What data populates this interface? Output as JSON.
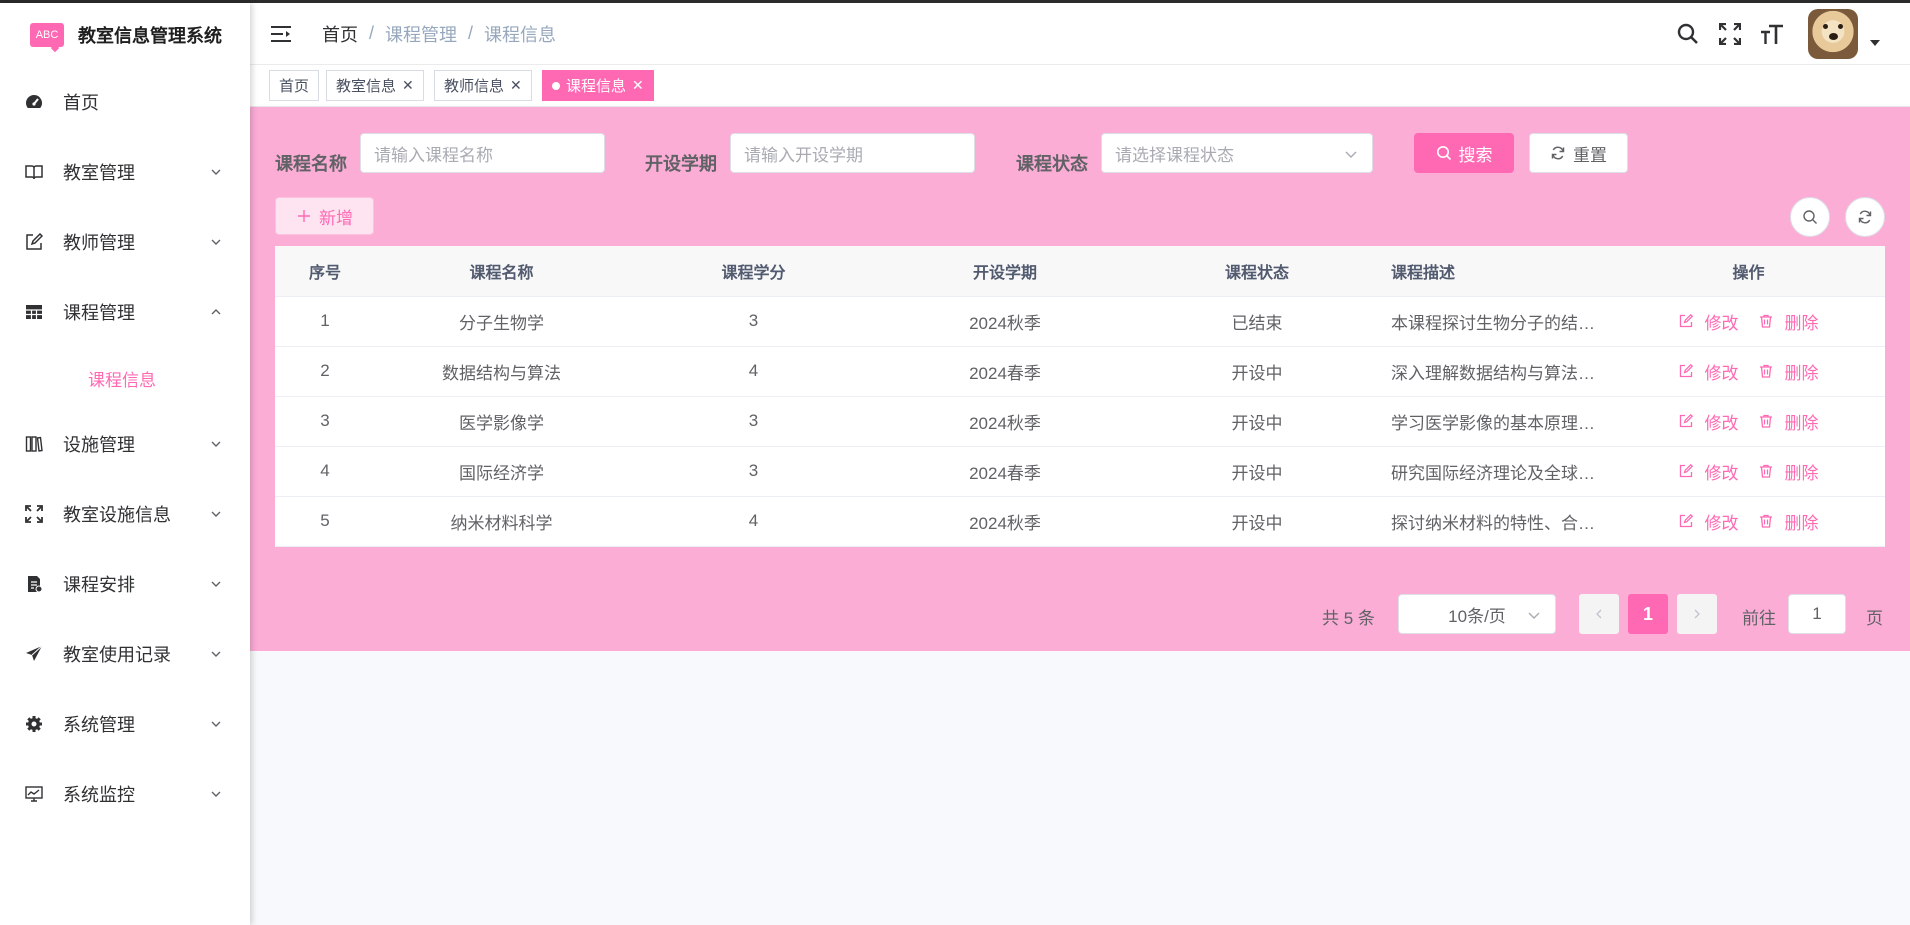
{
  "app": {
    "title": "教室信息管理系统",
    "logo_text": "ABC"
  },
  "sidebar": {
    "items": [
      {
        "label": "首页",
        "icon": "dashboard-icon",
        "expandable": false
      },
      {
        "label": "教室管理",
        "icon": "book-icon",
        "expandable": true
      },
      {
        "label": "教师管理",
        "icon": "edit-icon",
        "expandable": true
      },
      {
        "label": "课程管理",
        "icon": "table-icon",
        "expandable": true,
        "expanded": true,
        "children": [
          {
            "label": "课程信息",
            "active": true
          }
        ]
      },
      {
        "label": "设施管理",
        "icon": "books-icon",
        "expandable": true
      },
      {
        "label": "教室设施信息",
        "icon": "fullscreen-icon",
        "expandable": true
      },
      {
        "label": "课程安排",
        "icon": "document-icon",
        "expandable": true
      },
      {
        "label": "教室使用记录",
        "icon": "send-icon",
        "expandable": true
      },
      {
        "label": "系统管理",
        "icon": "gear-icon",
        "expandable": true
      },
      {
        "label": "系统监控",
        "icon": "monitor-icon",
        "expandable": true
      }
    ]
  },
  "header": {
    "breadcrumb": [
      "首页",
      "课程管理",
      "课程信息"
    ],
    "icons": [
      "search-icon",
      "fullscreen-icon",
      "font-size-icon"
    ]
  },
  "tags": [
    {
      "label": "首页",
      "closable": false,
      "active": false
    },
    {
      "label": "教室信息",
      "closable": true,
      "active": false
    },
    {
      "label": "教师信息",
      "closable": true,
      "active": false
    },
    {
      "label": "课程信息",
      "closable": true,
      "active": true
    }
  ],
  "filters": {
    "name": {
      "label": "课程名称",
      "placeholder": "请输入课程名称"
    },
    "term": {
      "label": "开设学期",
      "placeholder": "请输入开设学期"
    },
    "status": {
      "label": "课程状态",
      "placeholder": "请选择课程状态"
    },
    "search_label": "搜索",
    "reset_label": "重置"
  },
  "toolbar": {
    "add_label": "新增"
  },
  "table": {
    "columns": [
      "序号",
      "课程名称",
      "课程学分",
      "开设学期",
      "课程状态",
      "课程描述",
      "操作"
    ],
    "rows": [
      [
        "1",
        "分子生物学",
        "3",
        "2024秋季",
        "已结束",
        "本课程探讨生物分子的结…"
      ],
      [
        "2",
        "数据结构与算法",
        "4",
        "2024春季",
        "开设中",
        "深入理解数据结构与算法…"
      ],
      [
        "3",
        "医学影像学",
        "3",
        "2024秋季",
        "开设中",
        "学习医学影像的基本原理…"
      ],
      [
        "4",
        "国际经济学",
        "3",
        "2024春季",
        "开设中",
        "研究国际经济理论及全球…"
      ],
      [
        "5",
        "纳米材料科学",
        "4",
        "2024秋季",
        "开设中",
        "探讨纳米材料的特性、合…"
      ]
    ],
    "edit_label": "修改",
    "delete_label": "删除"
  },
  "pagination": {
    "total_text": "共 5 条",
    "page_size": "10条/页",
    "current_page": "1",
    "goto_label": "前往",
    "goto_value": "1",
    "page_unit": "页"
  },
  "colors": {
    "accent": "#ff69b4",
    "panel": "#fcadd6"
  }
}
